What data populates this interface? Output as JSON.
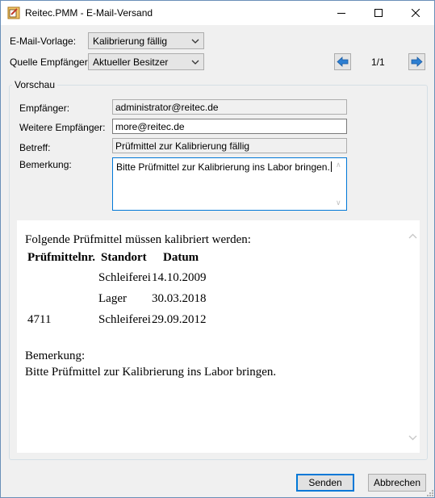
{
  "window": {
    "title": "Reitec.PMM - E-Mail-Versand"
  },
  "form": {
    "template_label": "E-Mail-Vorlage:",
    "template_value": "Kalibrierung fällig",
    "source_label": "Quelle Empfänger:",
    "source_value": "Aktueller Besitzer",
    "pager": "1/1"
  },
  "preview_group": {
    "title": "Vorschau",
    "recipient_label": "Empfänger:",
    "recipient_value": "administrator@reitec.de",
    "more_recipients_label": "Weitere Empfänger:",
    "more_recipients_value": "more@reitec.de",
    "subject_label": "Betreff:",
    "subject_value": "Prüfmittel zur Kalibrierung fällig",
    "remark_label": "Bemerkung:",
    "remark_value": "Bitte Prüfmittel zur Kalibrierung ins Labor bringen."
  },
  "mail_preview": {
    "intro": "Folgende Prüfmittel müssen kalibriert werden:",
    "headers": [
      "Prüfmittelnr.",
      "Standort",
      "Datum"
    ],
    "rows": [
      [
        "",
        "Schleiferei",
        "14.10.2009"
      ],
      [
        "",
        "Lager",
        "30.03.2018"
      ],
      [
        "4711",
        "Schleiferei",
        "29.09.2012"
      ]
    ],
    "remark_heading": "Bemerkung:",
    "remark_text": "Bitte Prüfmittel zur Kalibrierung ins Labor bringen."
  },
  "buttons": {
    "send": "Senden",
    "cancel": "Abbrechen"
  },
  "icons": {
    "app": "app-icon",
    "prev": "arrow-left-icon",
    "next": "arrow-right-icon"
  },
  "colors": {
    "accent": "#0078d7",
    "arrow_blue": "#2d7fd2"
  }
}
